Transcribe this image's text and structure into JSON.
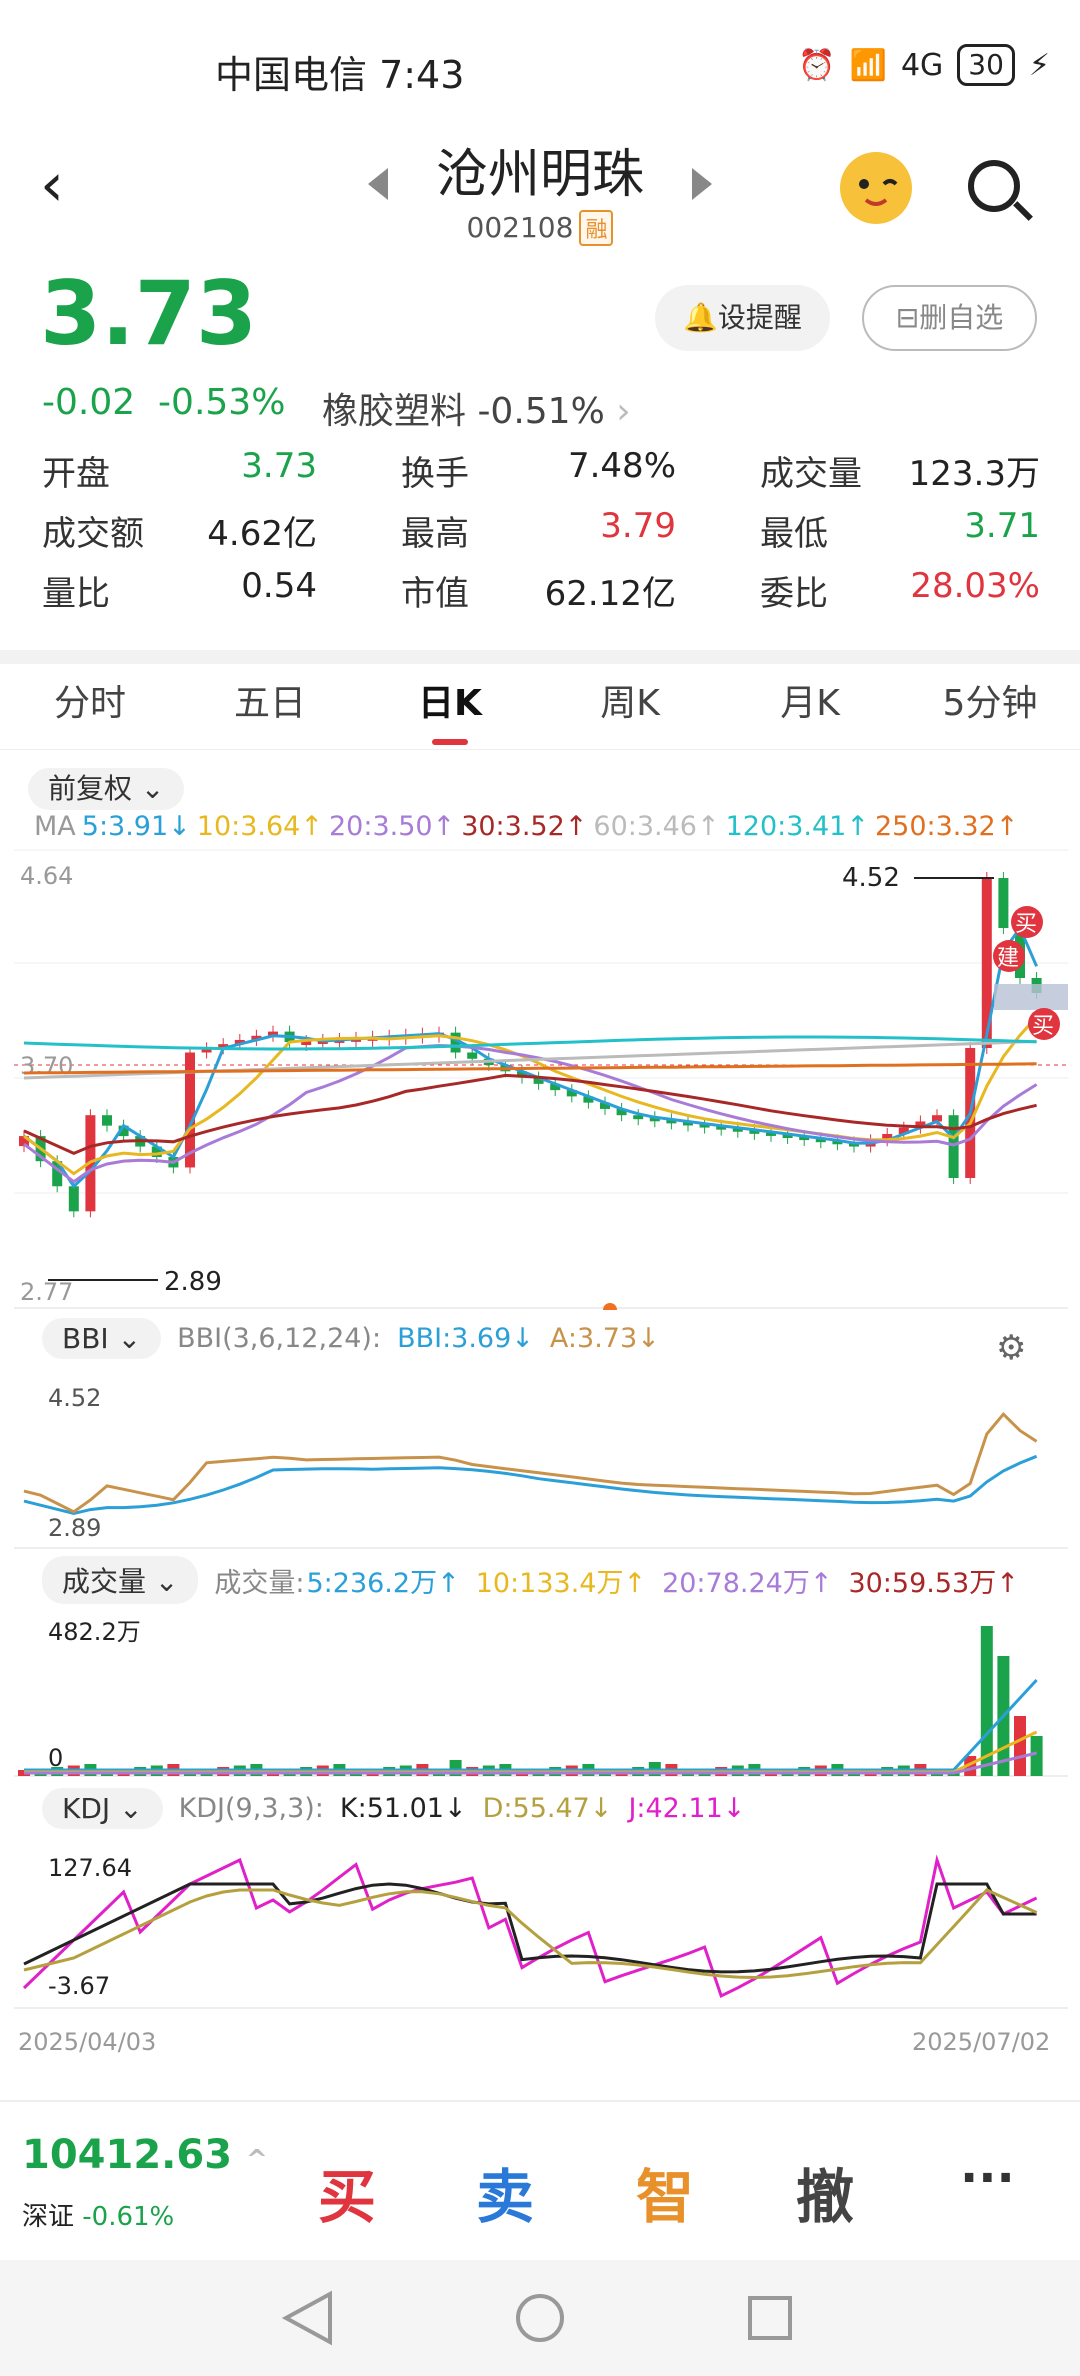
{
  "status_bar": {
    "carrier": "中国电信 7:43",
    "signal": "4G",
    "battery": "30"
  },
  "header": {
    "title": "沧州明珠",
    "code": "002108",
    "badge": "融"
  },
  "quote": {
    "price": "3.73",
    "change": "-0.02",
    "change_pct": "-0.53%",
    "sector": "橡胶塑料 -0.51%"
  },
  "buttons": {
    "alert": "设提醒",
    "remove": "删自选"
  },
  "stats": [
    [
      {
        "label": "开盘",
        "value": "3.73",
        "color": "green"
      },
      {
        "label": "换手",
        "value": "7.48%",
        "color": "dark"
      },
      {
        "label": "成交量",
        "value": "123.3万",
        "color": "dark"
      }
    ],
    [
      {
        "label": "成交额",
        "value": "4.62亿",
        "color": "dark"
      },
      {
        "label": "最高",
        "value": "3.79",
        "color": "red"
      },
      {
        "label": "最低",
        "value": "3.71",
        "color": "green"
      }
    ],
    [
      {
        "label": "量比",
        "value": "0.54",
        "color": "dark"
      },
      {
        "label": "市值",
        "value": "62.12亿",
        "color": "dark"
      },
      {
        "label": "委比",
        "value": "28.03%",
        "color": "red"
      }
    ]
  ],
  "tabs": [
    "分时",
    "五日",
    "日K",
    "周K",
    "月K",
    "5分钟"
  ],
  "active_tab": "日K",
  "adjust": "前复权",
  "ma_legend": [
    {
      "text": "MA",
      "color": "#999"
    },
    {
      "text": "5:3.91↓",
      "color": "#2a9fd8"
    },
    {
      "text": "10:3.64↑",
      "color": "#e8b820"
    },
    {
      "text": "20:3.50↑",
      "color": "#a87bd8"
    },
    {
      "text": "30:3.52↑",
      "color": "#a82828"
    },
    {
      "text": "60:3.46↑",
      "color": "#bbbbbb"
    },
    {
      "text": "120:3.41↑",
      "color": "#22c0c8"
    },
    {
      "text": "250:3.32↑",
      "color": "#e07020"
    }
  ],
  "main_chart": {
    "ymax": "4.64",
    "ymin": "2.77",
    "ref": "3.70",
    "hi_label": "4.52",
    "lo_label": "2.89",
    "buy1": "买",
    "build": "建",
    "buy2": "买"
  },
  "bbi": {
    "pill": "BBI",
    "params": "BBI(3,6,12,24):",
    "bbi": "BBI:3.69↓",
    "a": "A:3.73↓",
    "ymax": "4.52",
    "ymin": "2.89"
  },
  "volume": {
    "pill": "成交量",
    "title": "成交量:",
    "v5": "5:236.2万↑",
    "v10": "10:133.4万↑",
    "v20": "20:78.24万↑",
    "v30": "30:59.53万↑",
    "ymax": "482.2万",
    "ymin": "0"
  },
  "kdj": {
    "pill": "KDJ",
    "params": "KDJ(9,3,3):",
    "k": "K:51.01↓",
    "d": "D:55.47↓",
    "j": "J:42.11↓",
    "ymax": "127.64",
    "ymin": "-3.67",
    "date_start": "2025/04/03",
    "date_end": "2025/07/02"
  },
  "bottom": {
    "index_value": "10412.63",
    "index_name": "深证",
    "index_change": "-0.61%",
    "buy": "买",
    "sell": "卖",
    "smart": "智",
    "cancel": "撤",
    "more": "···"
  },
  "colors": {
    "up": "#e0343e",
    "down": "#1aa34a",
    "accent": "#e8902a"
  }
}
